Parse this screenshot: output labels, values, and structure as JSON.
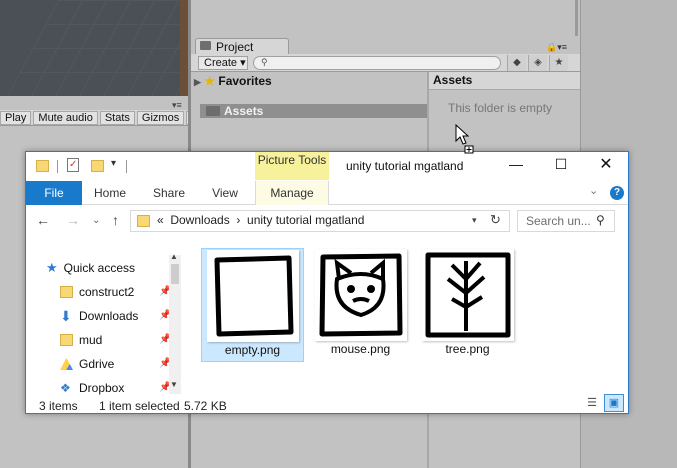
{
  "unity": {
    "game_bar": [
      "Play",
      "Mute audio",
      "Stats",
      "Gizmos"
    ],
    "project_tab": "Project",
    "create_label": "Create",
    "favorites_label": "Favorites",
    "assets_tree_label": "Assets",
    "assets_header": "Assets",
    "empty_message": "This folder is empty"
  },
  "explorer": {
    "picture_tools": "Picture Tools",
    "title": "unity tutorial mgatland",
    "ribbon_tabs": [
      "File",
      "Home",
      "Share",
      "View",
      "Manage"
    ],
    "address": "«  Downloads  ›  unity tutorial mgatland",
    "search_placeholder": "Search un...",
    "nav_items": [
      {
        "label": "Quick access",
        "icon": "star-icon",
        "pinned": false
      },
      {
        "label": "construct2",
        "icon": "folder-icon",
        "pinned": true
      },
      {
        "label": "Downloads",
        "icon": "download-icon",
        "pinned": true
      },
      {
        "label": "mud",
        "icon": "folder-icon",
        "pinned": true
      },
      {
        "label": "Gdrive",
        "icon": "gdrive-icon",
        "pinned": true
      },
      {
        "label": "Dropbox",
        "icon": "dropbox-icon",
        "pinned": true
      }
    ],
    "files": [
      {
        "name": "empty.png",
        "selected": true
      },
      {
        "name": "mouse.png",
        "selected": false
      },
      {
        "name": "tree.png",
        "selected": false
      }
    ],
    "status": {
      "count": "3 items",
      "selection": "1 item selected",
      "size": "5.72 KB"
    }
  }
}
